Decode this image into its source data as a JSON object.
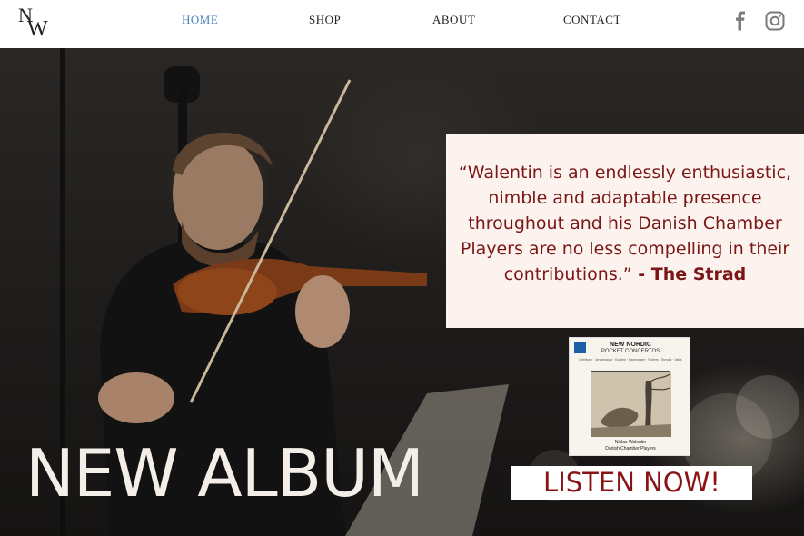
{
  "header": {
    "logo_letters": [
      "N",
      "W"
    ],
    "nav": [
      {
        "label": "HOME",
        "active": true
      },
      {
        "label": "SHOP",
        "active": false
      },
      {
        "label": "ABOUT",
        "active": false
      },
      {
        "label": "CONTACT",
        "active": false
      }
    ],
    "social": [
      {
        "name": "facebook-icon"
      },
      {
        "name": "instagram-icon"
      }
    ],
    "active_color": "#4a7fc1"
  },
  "hero": {
    "quote": "“Walentin is an endlessly enthusiastic, nimble and adaptable presence throughout and his Danish Chamber Players are no less compelling in their contributions.”",
    "quote_source": " - The Strad",
    "headline": "NEW ALBUM",
    "cta_label": "LISTEN NOW!",
    "accent_color": "#8a1414",
    "album": {
      "title": "NEW NORDIC",
      "subtitle": "POCKET CONCERTOS",
      "composers": "Gerritsen · Jorvenkauta · Kolsted · Rasmussen · Rubers · Tarnodi · Valks",
      "artist_line1": "Niklas Walentin",
      "artist_line2": "Danish Chamber Players"
    }
  }
}
